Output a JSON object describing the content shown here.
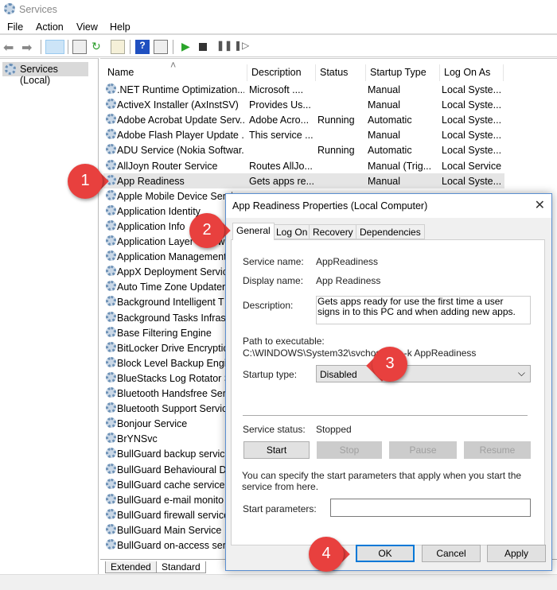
{
  "window": {
    "title": "Services"
  },
  "menu": [
    "File",
    "Action",
    "View",
    "Help"
  ],
  "toolbar": {
    "icons": [
      "back-icon",
      "forward-icon",
      "show-hide-console-tree-icon",
      "properties-icon",
      "refresh-icon",
      "export-list-icon",
      "help-icon",
      "show-action-pane-icon",
      "start-service-icon",
      "stop-service-icon",
      "pause-service-icon",
      "restart-service-icon"
    ]
  },
  "tree": {
    "root": "Services (Local)"
  },
  "columns": [
    "Name",
    "Description",
    "Status",
    "Startup Type",
    "Log On As"
  ],
  "rows": [
    {
      "name": ".NET Runtime Optimization...",
      "desc": "Microsoft ....",
      "status": "",
      "startup": "Manual",
      "logon": "Local Syste..."
    },
    {
      "name": "ActiveX Installer (AxInstSV)",
      "desc": "Provides Us...",
      "status": "",
      "startup": "Manual",
      "logon": "Local Syste..."
    },
    {
      "name": "Adobe Acrobat Update Serv...",
      "desc": "Adobe Acro...",
      "status": "Running",
      "startup": "Automatic",
      "logon": "Local Syste..."
    },
    {
      "name": "Adobe Flash Player Update ...",
      "desc": "This service ...",
      "status": "",
      "startup": "Manual",
      "logon": "Local Syste..."
    },
    {
      "name": "ADU Service (Nokia Softwar...",
      "desc": "",
      "status": "Running",
      "startup": "Automatic",
      "logon": "Local Syste..."
    },
    {
      "name": "AllJoyn Router Service",
      "desc": "Routes AllJo...",
      "status": "",
      "startup": "Manual (Trig...",
      "logon": "Local Service"
    },
    {
      "name": "App Readiness",
      "desc": "Gets apps re...",
      "status": "",
      "startup": "Manual",
      "logon": "Local Syste..."
    },
    {
      "name": "Apple Mobile Device Servi"
    },
    {
      "name": "Application Identity"
    },
    {
      "name": "Application Info"
    },
    {
      "name": "Application Layer Gatew"
    },
    {
      "name": "Application Management"
    },
    {
      "name": "AppX Deployment Servic"
    },
    {
      "name": "Auto Time Zone Updater"
    },
    {
      "name": "Background Intelligent T"
    },
    {
      "name": "Background Tasks Infrast"
    },
    {
      "name": "Base Filtering Engine"
    },
    {
      "name": "BitLocker Drive Encryptic"
    },
    {
      "name": "Block Level Backup Engir"
    },
    {
      "name": "BlueStacks Log Rotator S"
    },
    {
      "name": "Bluetooth Handsfree Serv"
    },
    {
      "name": "Bluetooth Support Servic"
    },
    {
      "name": "Bonjour Service"
    },
    {
      "name": "BrYNSvc"
    },
    {
      "name": "BullGuard backup service"
    },
    {
      "name": "BullGuard Behavioural De"
    },
    {
      "name": "BullGuard cache service"
    },
    {
      "name": "BullGuard e-mail monito"
    },
    {
      "name": "BullGuard firewall service"
    },
    {
      "name": "BullGuard Main Service"
    },
    {
      "name": "BullGuard on-access serv"
    }
  ],
  "bottom_tabs": [
    "Extended",
    "Standard"
  ],
  "dialog": {
    "title": "App Readiness Properties (Local Computer)",
    "tabs": [
      "General",
      "Log On",
      "Recovery",
      "Dependencies"
    ],
    "service_name_label": "Service name:",
    "service_name": "AppReadiness",
    "display_name_label": "Display name:",
    "display_name": "App Readiness",
    "description_label": "Description:",
    "description": "Gets apps ready for use the first time a user signs in to this PC and when adding new apps.",
    "path_label": "Path to executable:",
    "path": "C:\\WINDOWS\\System32\\svchost.exe -k AppReadiness",
    "startup_label": "Startup type:",
    "startup_value": "Disabled",
    "status_label": "Service status:",
    "status_value": "Stopped",
    "buttons": {
      "start": "Start",
      "stop": "Stop",
      "pause": "Pause",
      "resume": "Resume",
      "ok": "OK",
      "cancel": "Cancel",
      "apply": "Apply"
    },
    "params_hint": "You can specify the start parameters that apply when you start the service from here.",
    "params_label": "Start parameters:",
    "params_value": ""
  },
  "callouts": [
    "1",
    "2",
    "3",
    "4"
  ],
  "colors": {
    "callout": "#e8403e",
    "selection": "#e5e5e5",
    "focus": "#0078d7"
  }
}
